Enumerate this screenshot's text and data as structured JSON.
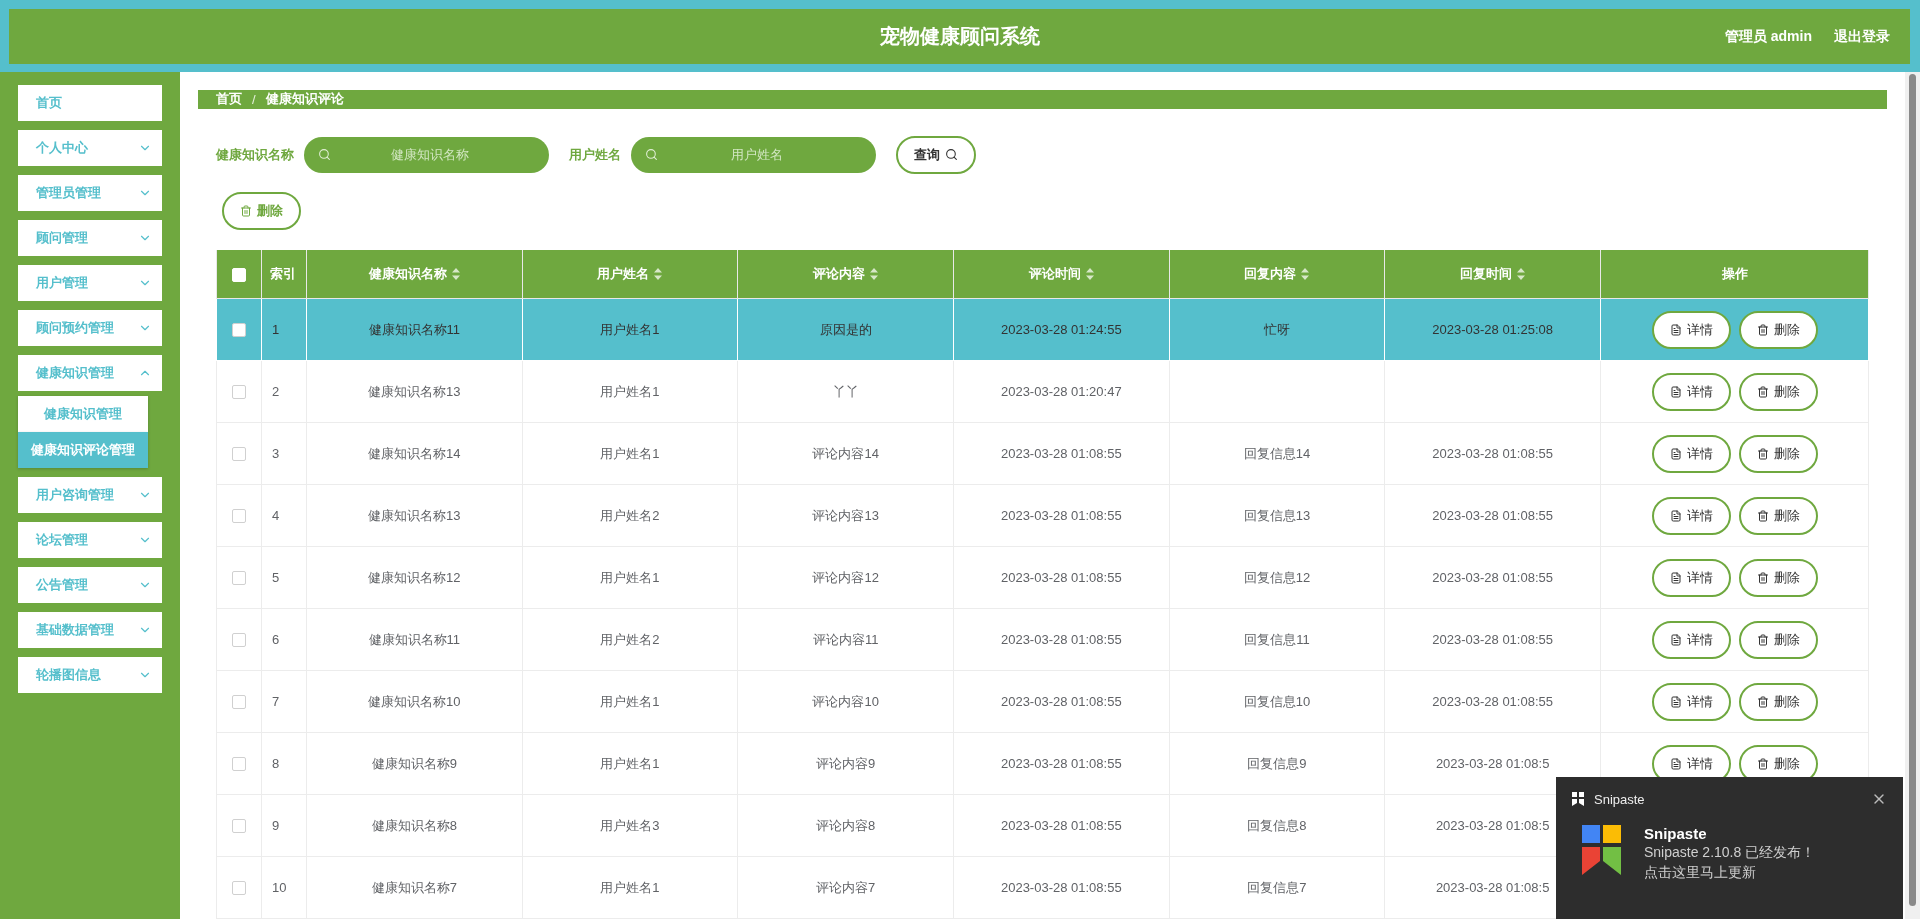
{
  "header": {
    "title": "宠物健康顾问系统",
    "user": "管理员 admin",
    "logout": "退出登录"
  },
  "sidebar": {
    "items": [
      {
        "label": "首页",
        "kind": "link"
      },
      {
        "label": "个人中心",
        "kind": "menu",
        "expanded": false
      },
      {
        "label": "管理员管理",
        "kind": "menu",
        "expanded": false
      },
      {
        "label": "顾问管理",
        "kind": "menu",
        "expanded": false
      },
      {
        "label": "用户管理",
        "kind": "menu",
        "expanded": false
      },
      {
        "label": "顾问预约管理",
        "kind": "menu",
        "expanded": false
      },
      {
        "label": "健康知识管理",
        "kind": "menu",
        "expanded": true,
        "children": [
          {
            "label": "健康知识管理",
            "selected": false
          },
          {
            "label": "健康知识评论管理",
            "selected": true
          }
        ]
      },
      {
        "label": "用户咨询管理",
        "kind": "menu",
        "expanded": false
      },
      {
        "label": "论坛管理",
        "kind": "menu",
        "expanded": false
      },
      {
        "label": "公告管理",
        "kind": "menu",
        "expanded": false
      },
      {
        "label": "基础数据管理",
        "kind": "menu",
        "expanded": false
      },
      {
        "label": "轮播图信息",
        "kind": "menu",
        "expanded": false
      }
    ]
  },
  "breadcrumb": {
    "items": [
      "首页",
      "健康知识评论"
    ],
    "separator": "/"
  },
  "search": {
    "fields": [
      {
        "label": "健康知识名称",
        "placeholder": "健康知识名称"
      },
      {
        "label": "用户姓名",
        "placeholder": "用户姓名"
      }
    ],
    "button": "查询"
  },
  "toolbar": {
    "delete_button": "删除"
  },
  "table": {
    "all_checked": false,
    "columns": [
      {
        "label": "索引",
        "sortable": false
      },
      {
        "label": "健康知识名称",
        "sortable": true
      },
      {
        "label": "用户姓名",
        "sortable": true
      },
      {
        "label": "评论内容",
        "sortable": true
      },
      {
        "label": "评论时间",
        "sortable": true
      },
      {
        "label": "回复内容",
        "sortable": true
      },
      {
        "label": "回复时间",
        "sortable": true
      },
      {
        "label": "操作",
        "sortable": false
      }
    ],
    "rows": [
      {
        "selected": true,
        "checked": false,
        "cells": [
          "1",
          "健康知识名称11",
          "用户姓名1",
          "原因是的",
          "2023-03-28 01:24:55",
          "忙呀",
          "2023-03-28 01:25:08"
        ],
        "actions": [
          "详情",
          "删除"
        ]
      },
      {
        "selected": false,
        "checked": false,
        "cells": [
          "2",
          "健康知识名称13",
          "用户姓名1",
          "丫丫",
          "2023-03-28 01:20:47",
          null,
          null
        ],
        "actions": [
          "详情",
          "删除"
        ]
      },
      {
        "selected": false,
        "checked": false,
        "cells": [
          "3",
          "健康知识名称14",
          "用户姓名1",
          "评论内容14",
          "2023-03-28 01:08:55",
          "回复信息14",
          "2023-03-28 01:08:55"
        ],
        "actions": [
          "详情",
          "删除"
        ]
      },
      {
        "selected": false,
        "checked": false,
        "cells": [
          "4",
          "健康知识名称13",
          "用户姓名2",
          "评论内容13",
          "2023-03-28 01:08:55",
          "回复信息13",
          "2023-03-28 01:08:55"
        ],
        "actions": [
          "详情",
          "删除"
        ]
      },
      {
        "selected": false,
        "checked": false,
        "cells": [
          "5",
          "健康知识名称12",
          "用户姓名1",
          "评论内容12",
          "2023-03-28 01:08:55",
          "回复信息12",
          "2023-03-28 01:08:55"
        ],
        "actions": [
          "详情",
          "删除"
        ]
      },
      {
        "selected": false,
        "checked": false,
        "cells": [
          "6",
          "健康知识名称11",
          "用户姓名2",
          "评论内容11",
          "2023-03-28 01:08:55",
          "回复信息11",
          "2023-03-28 01:08:55"
        ],
        "actions": [
          "详情",
          "删除"
        ]
      },
      {
        "selected": false,
        "checked": false,
        "cells": [
          "7",
          "健康知识名称10",
          "用户姓名1",
          "评论内容10",
          "2023-03-28 01:08:55",
          "回复信息10",
          "2023-03-28 01:08:55"
        ],
        "actions": [
          "详情",
          "删除"
        ]
      },
      {
        "selected": false,
        "checked": false,
        "cells": [
          "8",
          "健康知识名称9",
          "用户姓名1",
          "评论内容9",
          "2023-03-28 01:08:55",
          "回复信息9",
          "2023-03-28 01:08:5"
        ],
        "actions": [
          "详情",
          "删除"
        ]
      },
      {
        "selected": false,
        "checked": false,
        "cells": [
          "9",
          "健康知识名称8",
          "用户姓名3",
          "评论内容8",
          "2023-03-28 01:08:55",
          "回复信息8",
          "2023-03-28 01:08:5"
        ]
      },
      {
        "selected": false,
        "checked": false,
        "cells": [
          "10",
          "健康知识名称7",
          "用户姓名1",
          "评论内容7",
          "2023-03-28 01:08:55",
          "回复信息7",
          "2023-03-28 01:08:5"
        ]
      }
    ]
  },
  "notification": {
    "app": "Snipaste",
    "title": "Snipaste",
    "message": "Snipaste 2.10.8 已经发布！",
    "link": "点击这里马上更新"
  }
}
